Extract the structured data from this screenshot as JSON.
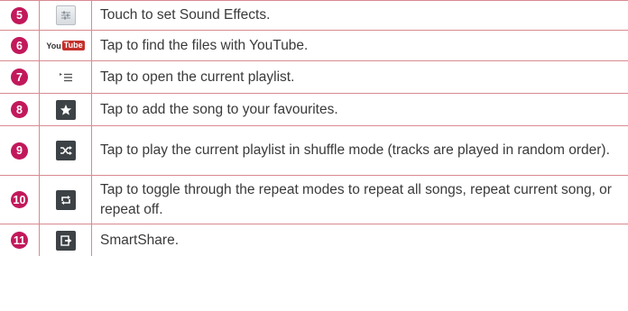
{
  "rows": [
    {
      "num": "5",
      "icon": "sound-effects-icon",
      "desc": "Touch to set Sound Effects."
    },
    {
      "num": "6",
      "icon": "youtube-icon",
      "icon_text_a": "You",
      "icon_text_b": "Tube",
      "desc": "Tap to find the files with YouTube."
    },
    {
      "num": "7",
      "icon": "playlist-icon",
      "desc": "Tap to open the current playlist."
    },
    {
      "num": "8",
      "icon": "star-icon",
      "desc": "Tap to add the song to your favourites."
    },
    {
      "num": "9",
      "icon": "shuffle-icon",
      "desc": "Tap to play the current playlist in shuffle mode (tracks are played in random order)."
    },
    {
      "num": "10",
      "icon": "repeat-icon",
      "desc": "Tap to toggle through the repeat modes to repeat all songs, repeat current song, or repeat off."
    },
    {
      "num": "11",
      "icon": "smartshare-icon",
      "desc": "SmartShare."
    }
  ],
  "colors": {
    "border": "#d98a91",
    "badge": "#c2185b",
    "text": "#3a3a3a",
    "icon_dark": "#3d4246"
  }
}
